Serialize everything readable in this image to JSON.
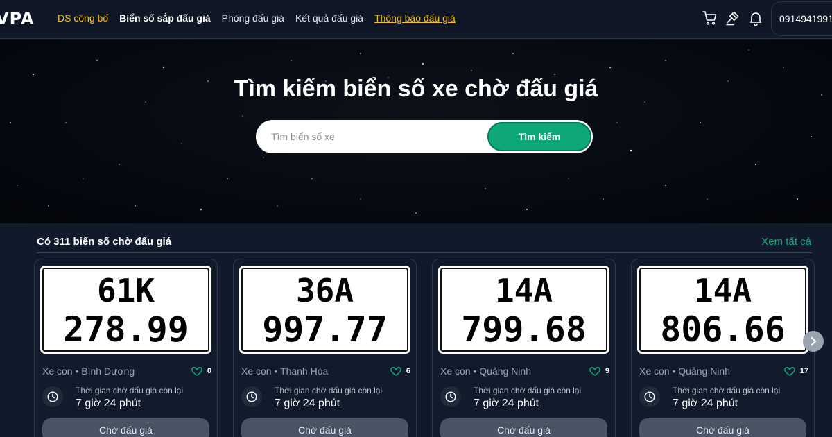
{
  "header": {
    "logo": "VPA",
    "nav": [
      {
        "label": "DS công bố"
      },
      {
        "label": "Biển số sắp đấu giá"
      },
      {
        "label": "Phòng đấu giá"
      },
      {
        "label": "Kết quả đấu giá"
      },
      {
        "label": "Thông báo đấu giá"
      }
    ],
    "phone": "0914941991",
    "icons": [
      "cart-icon",
      "gavel-icon",
      "bell-icon"
    ]
  },
  "hero": {
    "title": "Tìm kiếm biển số xe chờ đấu giá",
    "search_placeholder": "Tìm biển số xe",
    "search_value": "",
    "search_button": "Tìm kiếm"
  },
  "listing": {
    "count_title": "Có 311 biển số chờ đấu giá",
    "see_all": "Xem tất cả",
    "cards": [
      {
        "plate_line1": "61K",
        "plate_line2": "278.99",
        "meta": "Xe con  •  Bình Dương",
        "likes": "0",
        "time_label": "Thời gian chờ đấu giá còn lại",
        "time_value": "7 giờ 24 phút",
        "button": "Chờ đấu giá"
      },
      {
        "plate_line1": "36A",
        "plate_line2": "997.77",
        "meta": "Xe con  •  Thanh Hóa",
        "likes": "6",
        "time_label": "Thời gian chờ đấu giá còn lại",
        "time_value": "7 giờ 24 phút",
        "button": "Chờ đấu giá"
      },
      {
        "plate_line1": "14A",
        "plate_line2": "799.68",
        "meta": "Xe con  •  Quảng Ninh",
        "likes": "9",
        "time_label": "Thời gian chờ đấu giá còn lại",
        "time_value": "7 giờ 24 phút",
        "button": "Chờ đấu giá"
      },
      {
        "plate_line1": "14A",
        "plate_line2": "806.66",
        "meta": "Xe con  •  Quảng Ninh",
        "likes": "17",
        "time_label": "Thời gian chờ đấu giá còn lại",
        "time_value": "7 giờ 24 phút",
        "button": "Chờ đấu giá"
      }
    ]
  },
  "colors": {
    "accent_green": "#0ea878",
    "nav_yellow": "#f5c218",
    "background": "#0b1220"
  }
}
